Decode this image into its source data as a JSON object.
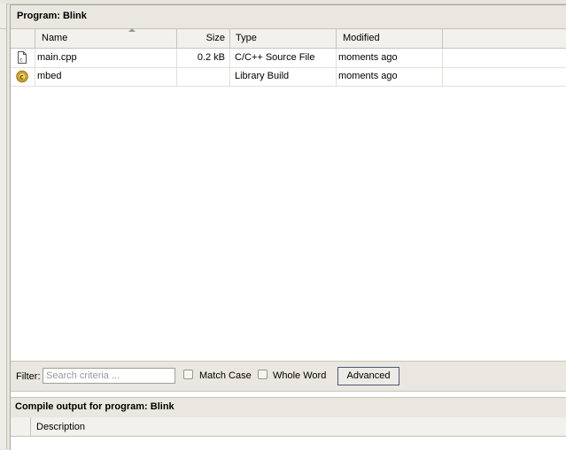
{
  "program_panel": {
    "title": "Program: Blink",
    "columns": {
      "name": "Name",
      "size": "Size",
      "type": "Type",
      "modified": "Modified"
    },
    "sort": {
      "column": "name",
      "direction": "ascending"
    },
    "files": [
      {
        "name": "main.cpp",
        "size": "0.2 kB",
        "type": "C/C++ Source File",
        "modified": "moments ago",
        "icon": "cpp-file-icon"
      },
      {
        "name": "mbed",
        "size": "",
        "type": "Library Build",
        "modified": "moments ago",
        "icon": "library-gear-icon"
      }
    ]
  },
  "filter": {
    "label": "Filter:",
    "placeholder": "Search criteria ...",
    "value": "",
    "match_case_label": "Match Case",
    "match_case_checked": false,
    "whole_word_label": "Whole Word",
    "whole_word_checked": false,
    "advanced_label": "Advanced"
  },
  "compile_output": {
    "title": "Compile output for program: Blink",
    "columns": {
      "description": "Description"
    }
  },
  "colors": {
    "chrome": "#e8e6df",
    "panel_bg": "#ffffff",
    "header_bg": "#f2f1ec",
    "button_border": "#4a5a7a"
  }
}
